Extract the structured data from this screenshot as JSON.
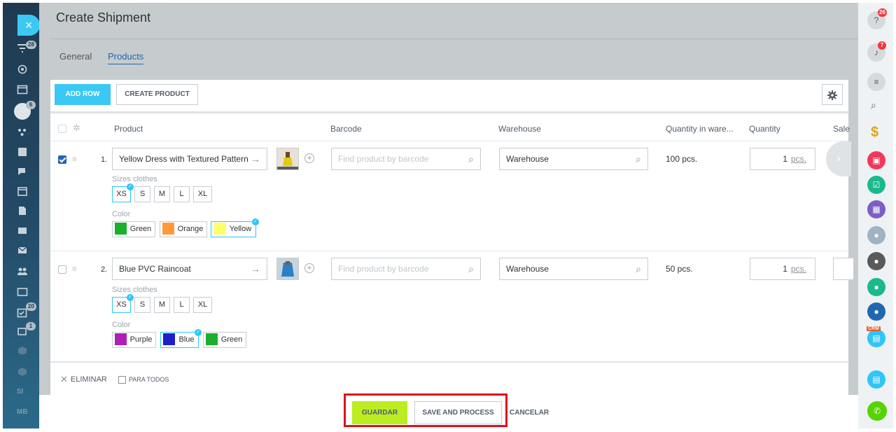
{
  "left_sidebar": {
    "close_glyph": "×",
    "badges": [
      "28",
      "6",
      "20",
      "1"
    ],
    "texts": [
      "SI",
      "MB"
    ]
  },
  "page": {
    "title": "Create Shipment",
    "tabs": [
      {
        "label": "General",
        "active": false
      },
      {
        "label": "Products",
        "active": true
      }
    ]
  },
  "toolbar": {
    "add_row": "ADD ROW",
    "create_product": "CREATE PRODUCT"
  },
  "table": {
    "columns": [
      "Product",
      "Barcode",
      "Warehouse",
      "Quantity in ware...",
      "Quantity",
      "Sale"
    ],
    "rows": [
      {
        "checked": true,
        "number": "1.",
        "product": "Yellow Dress with Textured Pattern",
        "barcode_placeholder": "Find product by barcode",
        "warehouse": "Warehouse",
        "stock": "100 pcs.",
        "quantity": "1",
        "unit": "pcs.",
        "size_label": "Sizes clothes",
        "sizes": [
          "XS",
          "S",
          "M",
          "L",
          "XL"
        ],
        "selected_size": "XS",
        "color_label": "Color",
        "colors": [
          {
            "name": "Green",
            "hex": "#1aaf2d"
          },
          {
            "name": "Orange",
            "hex": "#ff9a3c"
          },
          {
            "name": "Yellow",
            "hex": "#ffff66"
          }
        ],
        "selected_color": "Yellow"
      },
      {
        "checked": false,
        "number": "2.",
        "product": "Blue PVC Raincoat",
        "barcode_placeholder": "Find product by barcode",
        "warehouse": "Warehouse",
        "stock": "50 pcs.",
        "quantity": "1",
        "unit": "pcs.",
        "size_label": "Sizes clothes",
        "sizes": [
          "XS",
          "S",
          "M",
          "L",
          "XL"
        ],
        "selected_size": "XS",
        "color_label": "Color",
        "colors": [
          {
            "name": "Purple",
            "hex": "#b01fb3"
          },
          {
            "name": "Blue",
            "hex": "#1f1fc8"
          },
          {
            "name": "Green",
            "hex": "#1aaf2d"
          }
        ],
        "selected_color": "Blue"
      }
    ]
  },
  "footer": {
    "delete_label": "ELIMINAR",
    "for_all_label": "PARA TODOS"
  },
  "actions": {
    "save": "GUARDAR",
    "save_process": "SAVE AND PROCESS",
    "cancel": "CANCELAR"
  },
  "right_sidebar": {
    "help_badge": "26",
    "bell_badge": "7",
    "crm_label": "CRM"
  },
  "colors": {
    "accent_blue": "#3bc8f5",
    "save_green": "#bbed21",
    "highlight_red": "#d8141c"
  }
}
